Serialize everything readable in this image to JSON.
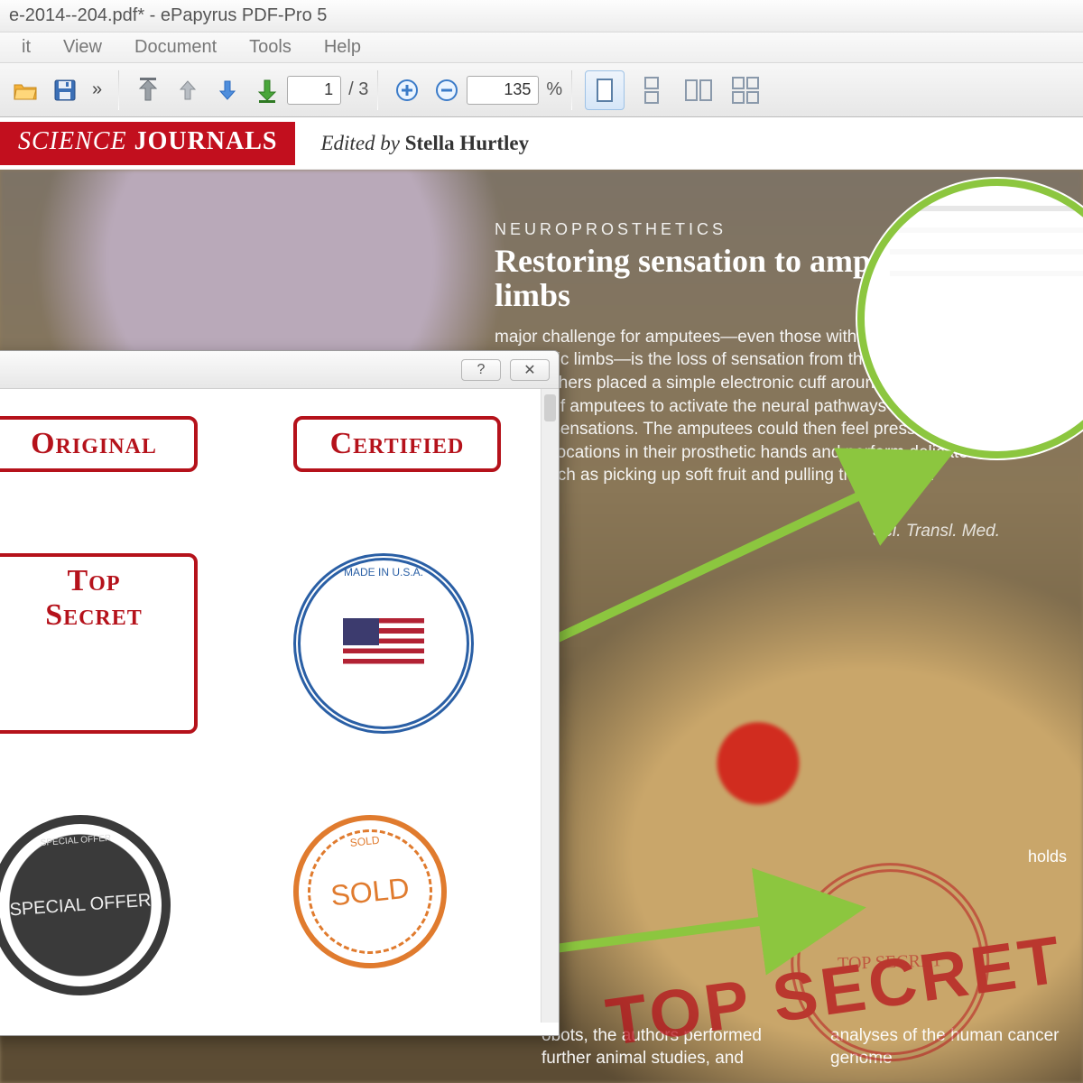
{
  "window": {
    "title": "e-2014--204.pdf* - ePapyrus PDF-Pro 5"
  },
  "menu": {
    "items": [
      "it",
      "View",
      "Document",
      "Tools",
      "Help"
    ]
  },
  "toolbar": {
    "page_current": "1",
    "page_sep": "/ 3",
    "zoom_value": "135",
    "zoom_unit": "%",
    "overflow": "»"
  },
  "banner": {
    "journal_left": "SCIENCE",
    "journal_right": "JOURNALS",
    "edited_prefix": "Edited by ",
    "editor": "Stella Hurtley"
  },
  "article": {
    "kicker": "NEUROPROSTHETICS",
    "headline": "Restoring sensation to amputated limbs",
    "body": "major challenge for amputees—even those with advanced prosthetic limbs—is the loss of sensation from the missing hand. Researchers placed a simple electronic cuff around the residual nerves of amputees to activate the neural pathways that once carried sensations. The amputees could then feel pressure at distinct locations in their prosthetic hands and perform delicate tasks such as picking up soft fruit and pulling the stalks off cherries.",
    "citation": "Sci. Transl. Med.",
    "caption_right": "holds",
    "frag1": "obots, the authors performed further animal studies, and",
    "frag2": "analyses of the human cancer genome"
  },
  "dialog": {
    "help": "?",
    "close": "✕",
    "stamps": {
      "original": "Original",
      "certified": "Certified",
      "topsecret": "Top Secret",
      "madeusa_ring": "MADE IN U.S.A.",
      "sold": "SOLD",
      "sold_small": "SOLD",
      "special": "SPECIAL OFFER",
      "special_small": "SPECIAL OFFER"
    }
  },
  "applied": {
    "ring": "TOP SECRET",
    "big": "TOP SECRET"
  }
}
